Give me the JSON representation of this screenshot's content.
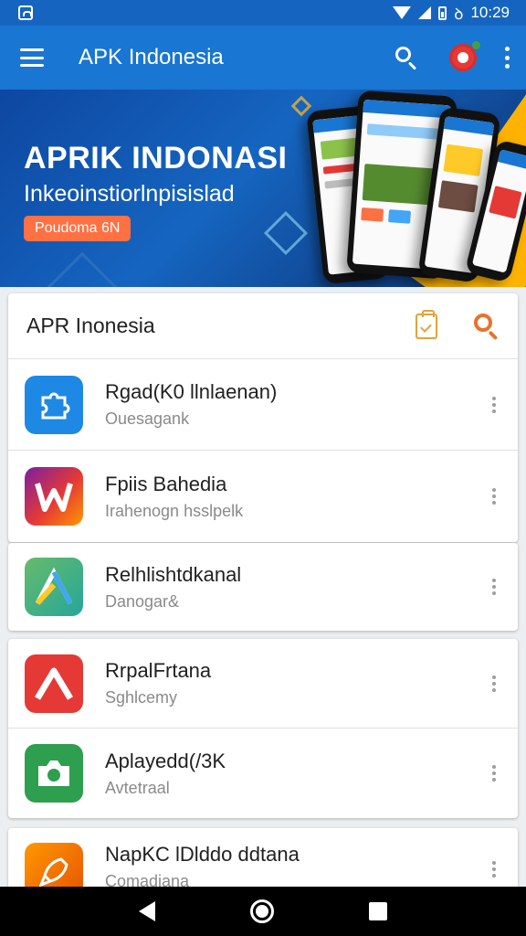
{
  "status_bar": {
    "time": "10:29",
    "battery_prefix": "ꝺ"
  },
  "app_bar": {
    "title": "APK Indonesia"
  },
  "banner": {
    "title": "APRIK INDONASI",
    "subtitle": "Inkeoinstiorlnpisislad",
    "button_label": "Poudoma 6N"
  },
  "cards": [
    {
      "header": "APR Inonesia",
      "items": [
        {
          "title": "Rgad(K0 llnlaenan)",
          "subtitle": "Ouesagank",
          "icon": "puzzle-icon",
          "color": "#2196f3"
        },
        {
          "title": "Fpiis Bahedia",
          "subtitle": "Irahenogn hsslpelk",
          "icon": "w-letter-icon",
          "color": "#e53935"
        }
      ]
    },
    {
      "items": [
        {
          "title": "Relhlishtdkanal",
          "subtitle": "Danogar&",
          "icon": "triangle-play-icon",
          "color": "#43a047"
        }
      ]
    },
    {
      "items": [
        {
          "title": "RrpalFrtana",
          "subtitle": "Sghlcemy",
          "icon": "a-letter-icon",
          "color": "#e53935"
        },
        {
          "title": "Aplayedd(/3K",
          "subtitle": "Avtetraal",
          "icon": "camera-icon",
          "color": "#2e9e4f"
        }
      ]
    },
    {
      "items": [
        {
          "title": "NapKC lDlddo ddtana",
          "subtitle": "Comadiana",
          "icon": "rocket-icon",
          "color": "#ef6c00"
        }
      ]
    }
  ]
}
